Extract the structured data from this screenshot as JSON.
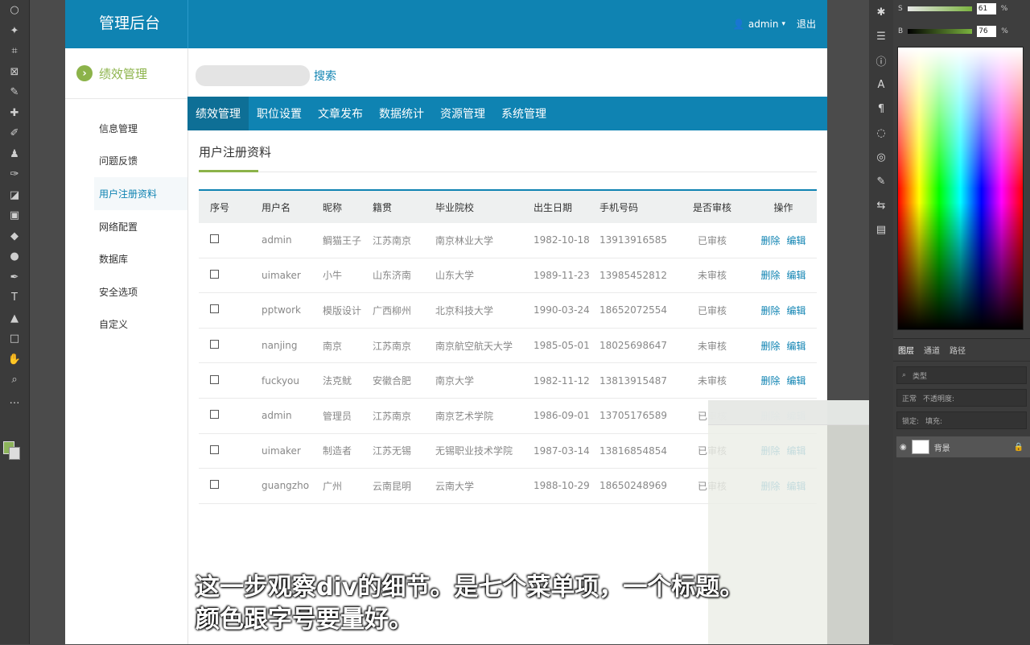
{
  "app": {
    "logo": "管理后台",
    "user": "admin",
    "logout": "退出"
  },
  "sidebar": {
    "title": "绩效管理",
    "items": [
      {
        "label": "信息管理"
      },
      {
        "label": "问题反馈"
      },
      {
        "label": "用户注册资料",
        "active": true
      },
      {
        "label": "网络配置"
      },
      {
        "label": "数据库"
      },
      {
        "label": "安全选项"
      },
      {
        "label": "自定义"
      }
    ]
  },
  "search": {
    "placeholder": "",
    "button": "搜索"
  },
  "nav": {
    "items": [
      {
        "label": "绩效管理",
        "active": true
      },
      {
        "label": "职位设置"
      },
      {
        "label": "文章发布"
      },
      {
        "label": "数据统计"
      },
      {
        "label": "资源管理"
      },
      {
        "label": "系统管理"
      }
    ]
  },
  "page": {
    "title": "用户注册资料"
  },
  "table": {
    "headers": [
      "序号",
      "用户名",
      "昵称",
      "籍贯",
      "毕业院校",
      "出生日期",
      "手机号码",
      "是否审核",
      "操作"
    ],
    "rows": [
      {
        "username": "admin",
        "nickname": "鲷猫王子",
        "origin": "江苏南京",
        "school": "南京林业大学",
        "birth": "1982-10-18",
        "phone": "13913916585",
        "status": "已审核"
      },
      {
        "username": "uimaker",
        "nickname": "小牛",
        "origin": "山东济南",
        "school": "山东大学",
        "birth": "1989-11-23",
        "phone": "13985452812",
        "status": "未审核"
      },
      {
        "username": "pptwork",
        "nickname": "模版设计",
        "origin": "广西柳州",
        "school": "北京科技大学",
        "birth": "1990-03-24",
        "phone": "18652072554",
        "status": "已审核"
      },
      {
        "username": "nanjing",
        "nickname": "南京",
        "origin": "江苏南京",
        "school": "南京航空航天大学",
        "birth": "1985-05-01",
        "phone": "18025698647",
        "status": "未审核"
      },
      {
        "username": "fuckyou",
        "nickname": "法克鱿",
        "origin": "安徽合肥",
        "school": "南京大学",
        "birth": "1982-11-12",
        "phone": "13813915487",
        "status": "未审核"
      },
      {
        "username": "admin",
        "nickname": "管理员",
        "origin": "江苏南京",
        "school": "南京艺术学院",
        "birth": "1986-09-01",
        "phone": "13705176589",
        "status": "已审核"
      },
      {
        "username": "uimaker",
        "nickname": "制造者",
        "origin": "江苏无锡",
        "school": "无锡职业技术学院",
        "birth": "1987-03-14",
        "phone": "13816854854",
        "status": "已审核"
      },
      {
        "username": "guangzho",
        "nickname": "广州",
        "origin": "云南昆明",
        "school": "云南大学",
        "birth": "1988-10-29",
        "phone": "18650248969",
        "status": "已审核"
      }
    ],
    "actions": {
      "delete": "删除",
      "edit": "编辑"
    }
  },
  "photoshop": {
    "s_value": "61",
    "b_value": "76",
    "percent": "%",
    "layers_tabs": [
      "图层",
      "通道",
      "路径"
    ],
    "kind": "类型",
    "blend": "正常",
    "opacity_label": "不透明度:",
    "lock_label": "锁定:",
    "fill_label": "填充:",
    "layer_name": "背景"
  },
  "caption": {
    "line1": "这一步观察div的细节。是七个菜单项，一个标题。",
    "line2": "颜色跟字号要量好。"
  }
}
